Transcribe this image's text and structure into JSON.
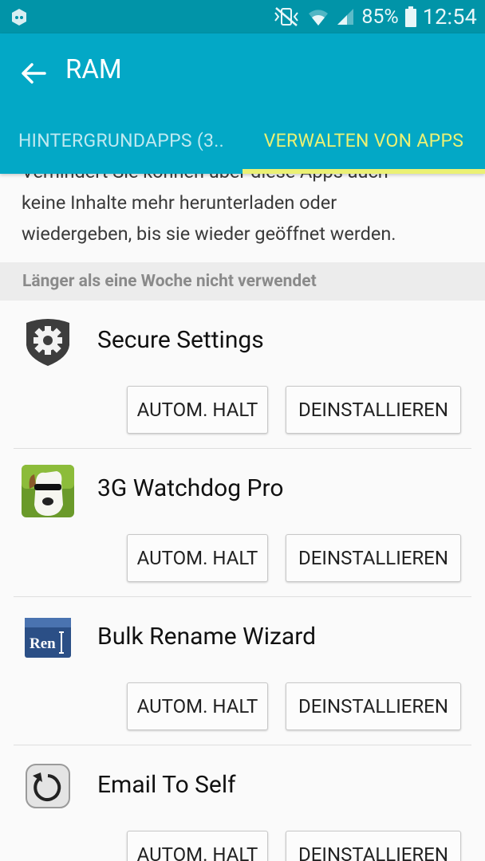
{
  "status_bar": {
    "battery_percent": "85%",
    "time": "12:54",
    "icons": [
      "notification-app-icon",
      "mute-vibrate-icon",
      "wifi-icon",
      "signal-icon",
      "battery-icon"
    ]
  },
  "app_bar": {
    "title": "RAM",
    "back_icon": "arrow-back-icon",
    "background": "#03a8c6",
    "status_bg": "#0194a8",
    "accent": "#ebf174"
  },
  "tabs": [
    {
      "label": "HINTERGRUNDAPPS (3..",
      "active": false
    },
    {
      "label": "VERWALTEN VON APPS",
      "active": true
    }
  ],
  "intro_text": {
    "partial_line": "Verhindert Sie können über diese Apps auch",
    "line2": "keine Inhalte mehr herunterladen oder",
    "line3": "wiedergeben, bis sie wieder geöffnet werden."
  },
  "section_header": "Länger als eine Woche nicht verwendet",
  "apps": [
    {
      "name": "Secure Settings",
      "icon": "secure-settings-gear-shield-icon",
      "halt_label": "AUTOM. HALT",
      "uninstall_label": "DEINSTALLIEREN"
    },
    {
      "name": "3G Watchdog Pro",
      "icon": "watchdog-dog-icon",
      "halt_label": "AUTOM. HALT",
      "uninstall_label": "DEINSTALLIEREN"
    },
    {
      "name": "Bulk Rename Wizard",
      "icon": "bulk-rename-ren-icon",
      "icon_text": "Ren",
      "halt_label": "AUTOM. HALT",
      "uninstall_label": "DEINSTALLIEREN"
    },
    {
      "name": "Email To Self",
      "icon": "email-to-self-refresh-icon",
      "halt_label": "AUTOM. HALT",
      "uninstall_label": "DEINSTALLIEREN"
    }
  ]
}
